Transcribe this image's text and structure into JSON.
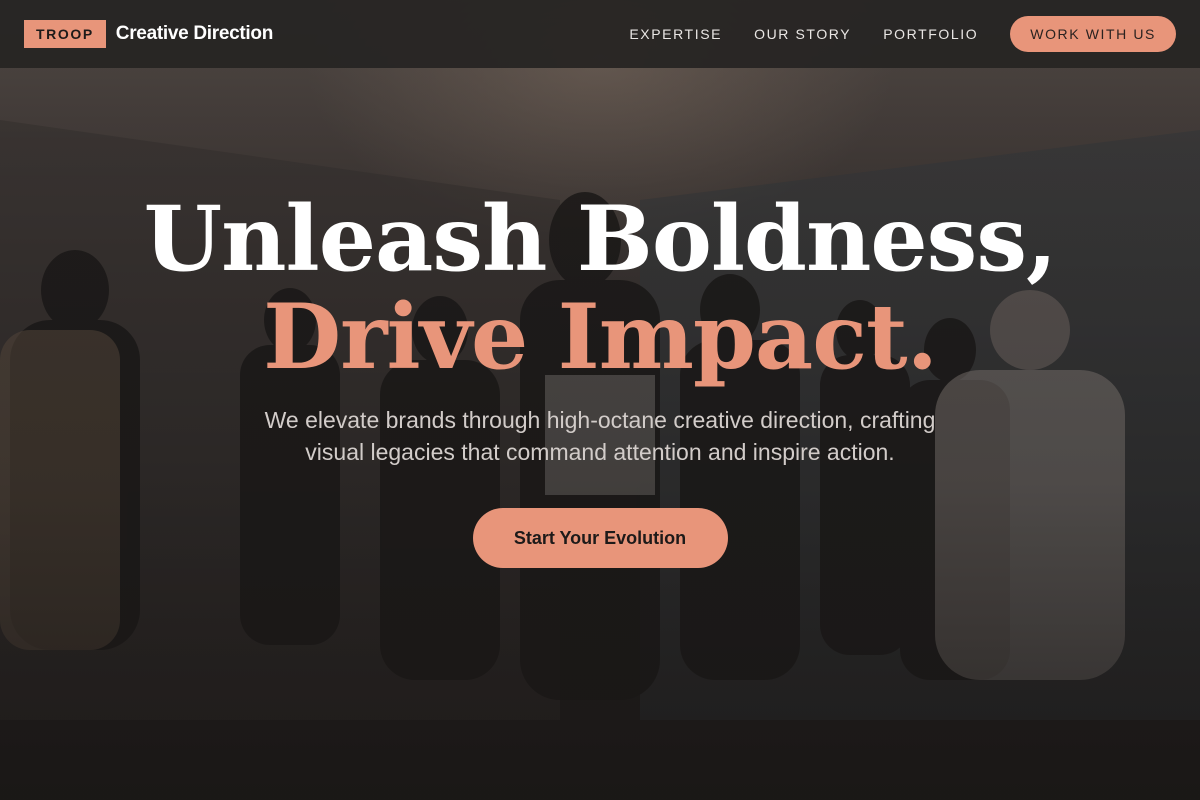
{
  "brand": {
    "badge": "TROOP",
    "name": "Creative Direction"
  },
  "nav": {
    "links": [
      "EXPERTISE",
      "OUR STORY",
      "PORTFOLIO"
    ],
    "cta": "WORK WITH US"
  },
  "hero": {
    "headline_line1": "Unleash Boldness,",
    "headline_line2": "Drive Impact.",
    "subtext": "We elevate brands through high-octane creative direction, crafting visual legacies that command attention and inspire action.",
    "cta": "Start Your Evolution",
    "background_image": "photo of a group of fashion models in stylish outfits posing together on a stage"
  },
  "colors": {
    "accent": "#e8957a",
    "navbar_bg": "#262423",
    "text_light": "#ffffff",
    "text_muted": "#d2ccc9"
  }
}
